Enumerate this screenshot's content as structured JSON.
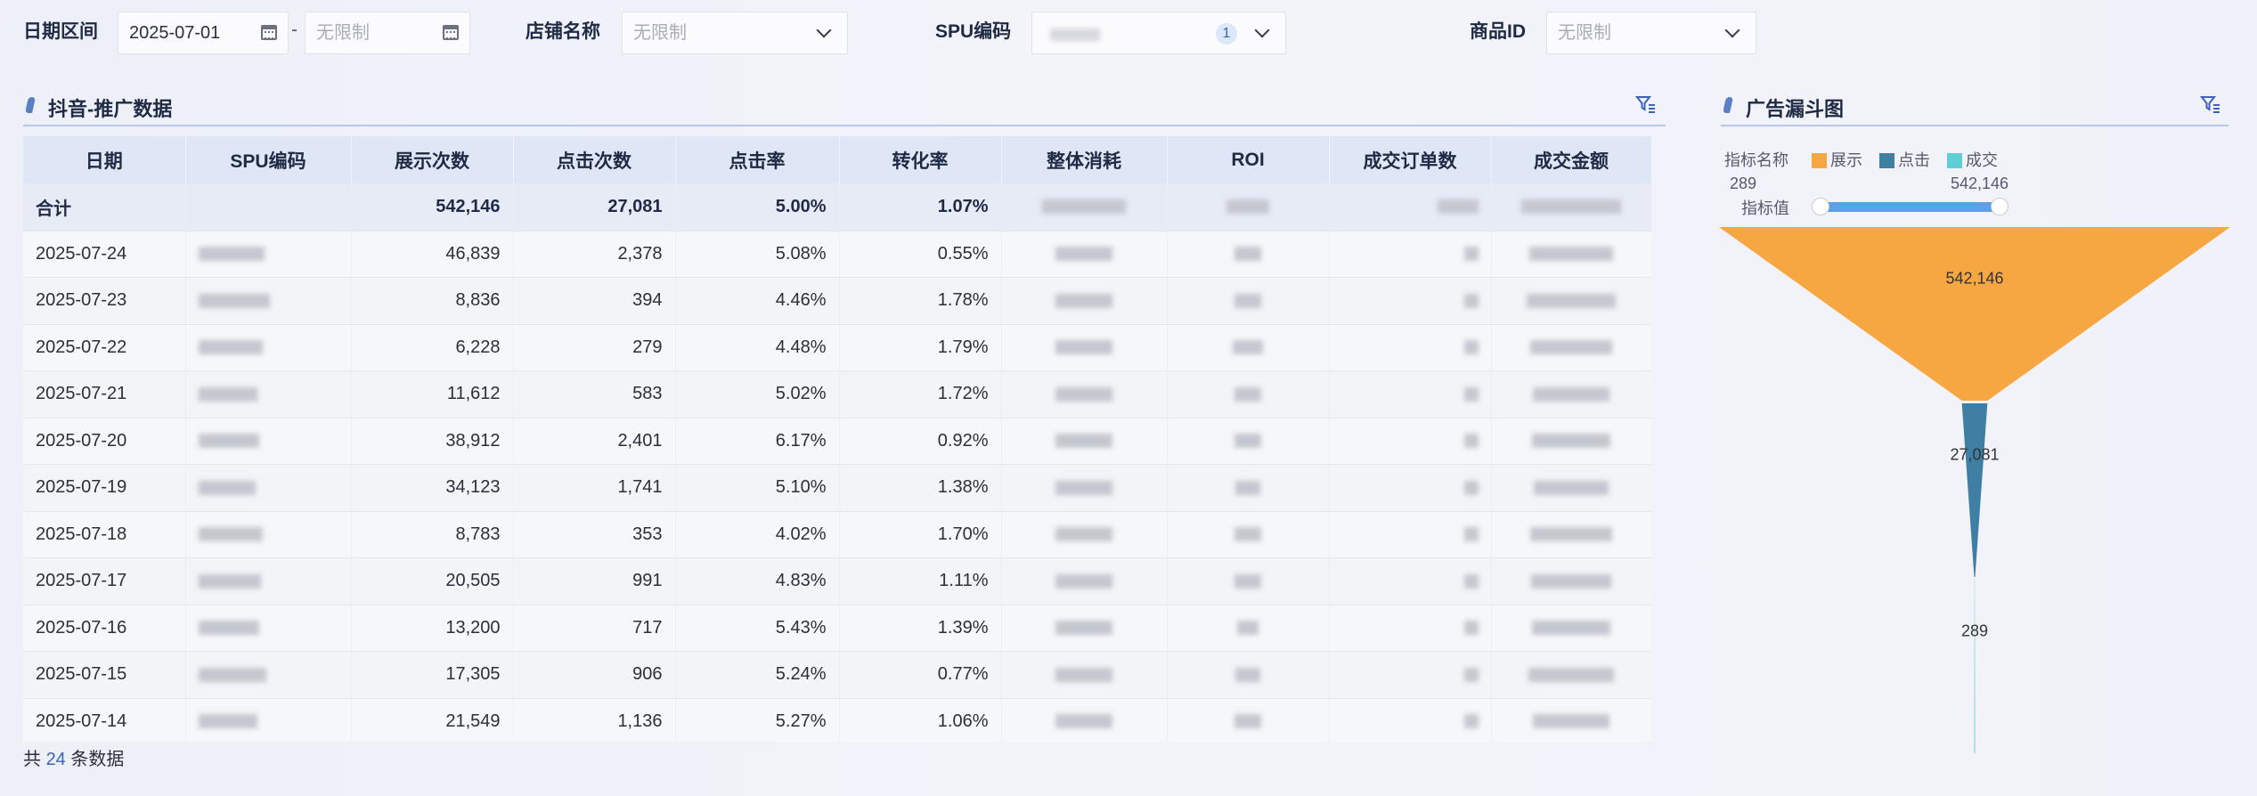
{
  "filters": {
    "date_label": "日期区间",
    "date_start": "2025-07-01",
    "date_sep": "-",
    "date_end_placeholder": "无限制",
    "store_label": "店铺名称",
    "store_placeholder": "无限制",
    "spu_label": "SPU编码",
    "spu_selected_count": "1",
    "product_label": "商品ID",
    "product_placeholder": "无限制"
  },
  "table_section": {
    "title": "抖音-推广数据",
    "columns": [
      "日期",
      "SPU编码",
      "展示次数",
      "点击次数",
      "点击率",
      "转化率",
      "整体消耗",
      "ROI",
      "成交订单数",
      "成交金额"
    ],
    "total": {
      "label": "合计",
      "impressions": "542,146",
      "clicks": "27,081",
      "ctr": "5.00%",
      "cvr": "1.07%"
    },
    "rows": [
      {
        "date": "2025-07-24",
        "impressions": "46,839",
        "clicks": "2,378",
        "ctr": "5.08%",
        "cvr": "0.55%"
      },
      {
        "date": "2025-07-23",
        "impressions": "8,836",
        "clicks": "394",
        "ctr": "4.46%",
        "cvr": "1.78%"
      },
      {
        "date": "2025-07-22",
        "impressions": "6,228",
        "clicks": "279",
        "ctr": "4.48%",
        "cvr": "1.79%"
      },
      {
        "date": "2025-07-21",
        "impressions": "11,612",
        "clicks": "583",
        "ctr": "5.02%",
        "cvr": "1.72%"
      },
      {
        "date": "2025-07-20",
        "impressions": "38,912",
        "clicks": "2,401",
        "ctr": "6.17%",
        "cvr": "0.92%"
      },
      {
        "date": "2025-07-19",
        "impressions": "34,123",
        "clicks": "1,741",
        "ctr": "5.10%",
        "cvr": "1.38%"
      },
      {
        "date": "2025-07-18",
        "impressions": "8,783",
        "clicks": "353",
        "ctr": "4.02%",
        "cvr": "1.70%"
      },
      {
        "date": "2025-07-17",
        "impressions": "20,505",
        "clicks": "991",
        "ctr": "4.83%",
        "cvr": "1.11%"
      },
      {
        "date": "2025-07-16",
        "impressions": "13,200",
        "clicks": "717",
        "ctr": "5.43%",
        "cvr": "1.39%"
      },
      {
        "date": "2025-07-15",
        "impressions": "17,305",
        "clicks": "906",
        "ctr": "5.24%",
        "cvr": "0.77%"
      },
      {
        "date": "2025-07-14",
        "impressions": "21,549",
        "clicks": "1,136",
        "ctr": "5.27%",
        "cvr": "1.06%"
      }
    ],
    "footer_prefix": "共",
    "footer_count": "24",
    "footer_suffix": "条数据"
  },
  "funnel_section": {
    "title": "广告漏斗图",
    "legend_title": "指标名称",
    "slider_label": "指标值",
    "slider_min": "289",
    "slider_max": "542,146"
  },
  "chart_data": {
    "type": "funnel",
    "categories": [
      "展示",
      "点击",
      "成交"
    ],
    "values": [
      542146,
      27081,
      289
    ],
    "value_labels": [
      "542,146",
      "27,081",
      "289"
    ],
    "colors": [
      "#f6a742",
      "#3f7fa3",
      "#5fcfd6"
    ],
    "legend_placement": "top-left"
  },
  "icons": {
    "date_picker": "calendar-icon",
    "dropdown": "chevron-down-icon",
    "section_filter": "filter-icon"
  }
}
